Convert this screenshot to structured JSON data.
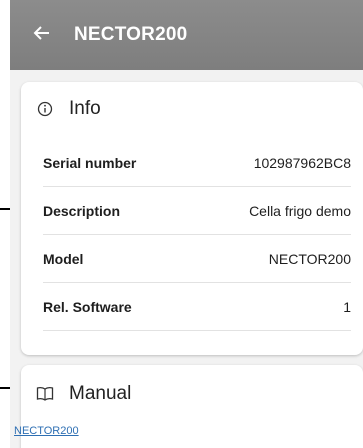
{
  "appbar": {
    "back_icon": "arrow-left-icon",
    "title": "NECTOR200"
  },
  "info": {
    "icon": "info-circle-icon",
    "title": "Info",
    "rows": [
      {
        "label": "Serial number",
        "value": "102987962BC8"
      },
      {
        "label": "Description",
        "value": "Cella frigo demo"
      },
      {
        "label": "Model",
        "value": "NECTOR200"
      },
      {
        "label": "Rel. Software",
        "value": "1"
      }
    ]
  },
  "manual": {
    "icon": "book-open-icon",
    "title": "Manual",
    "link_text": "NECTOR200"
  },
  "colors": {
    "appbar": "#858585",
    "background": "#f2f2f2",
    "card": "#ffffff",
    "link": "#2e6fb3",
    "annotation_arrow": "#000000"
  }
}
